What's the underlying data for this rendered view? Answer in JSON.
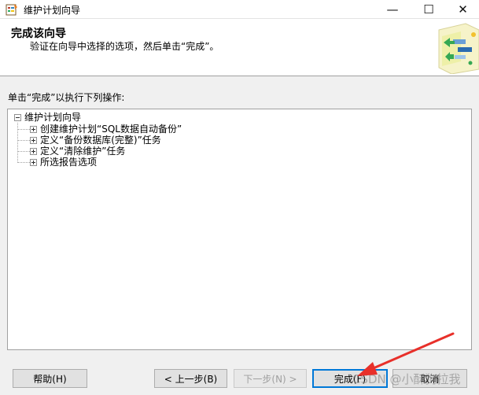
{
  "window": {
    "title": "维护计划向导",
    "minimize_glyph": "—",
    "maximize_glyph": "☐",
    "close_glyph": "✕"
  },
  "header": {
    "title": "完成该向导",
    "description": "验证在向导中选择的选项，然后单击“完成”。"
  },
  "instruction": "单击“完成”以执行下列操作:",
  "tree": {
    "root": "维护计划向导",
    "children": [
      "创建维护计划“SQL数据自动备份”",
      "定义“备份数据库(完整)”任务",
      "定义“清除维护”任务",
      "所选报告选项"
    ]
  },
  "buttons": {
    "help": "帮助(H)",
    "back": "< 上一步(B)",
    "next": "下一步(N) >",
    "finish": "完成(F)",
    "cancel": "取消"
  },
  "watermark": "CSDN @小酥狗拉我",
  "colors": {
    "accent": "#0078d7",
    "annotation_arrow": "#e8302a"
  }
}
